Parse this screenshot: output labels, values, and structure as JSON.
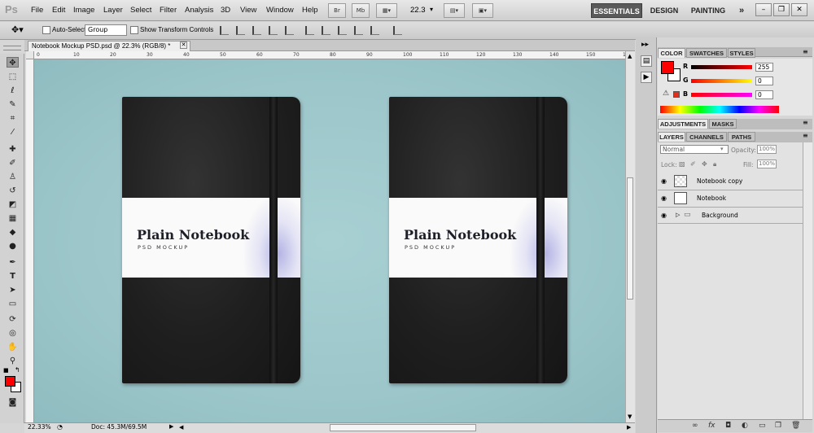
{
  "app": {
    "logo": "Ps"
  },
  "menu": [
    "File",
    "Edit",
    "Image",
    "Layer",
    "Select",
    "Filter",
    "Analysis",
    "3D",
    "View",
    "Window",
    "Help"
  ],
  "appbar": {
    "bridge_label": "Br",
    "minibridge_label": "Mb",
    "zoom": "22.3"
  },
  "workspaces": {
    "essentials": "ESSENTIALS",
    "design": "DESIGN",
    "painting": "PAINTING",
    "more": "»"
  },
  "options": {
    "auto_select_label": "Auto-Select:",
    "auto_select_value": "Group",
    "transform_label": "Show Transform Controls"
  },
  "document": {
    "tab_title": "Notebook Mockup PSD.psd @ 22.3% (RGB/8) *",
    "ruler_ticks": [
      "0",
      "10",
      "20",
      "30",
      "40",
      "50",
      "60",
      "70",
      "80",
      "90",
      "100",
      "110",
      "120",
      "130",
      "140",
      "150",
      "160"
    ],
    "zoom_status": "22.33%",
    "doc_status": "Doc: 45.3M/69.5M"
  },
  "notebooks": [
    {
      "title": "Plain Notebook",
      "subtitle": "PSD MOCKUP"
    },
    {
      "title": "Plain Notebook",
      "subtitle": "PSD MOCKUP"
    }
  ],
  "color_panel": {
    "tabs": [
      "COLOR",
      "SWATCHES",
      "STYLES"
    ],
    "r_label": "R",
    "g_label": "G",
    "b_label": "B",
    "r": "255",
    "g": "0",
    "b": "0",
    "fg_color": "#ff0000",
    "bg_color": "#ffffff"
  },
  "adjust_panel": {
    "tabs": [
      "ADJUSTMENTS",
      "MASKS"
    ]
  },
  "layers_panel": {
    "tabs": [
      "LAYERS",
      "CHANNELS",
      "PATHS"
    ],
    "blend_mode": "Normal",
    "opacity_label": "Opacity:",
    "opacity": "100%",
    "lock_label": "Lock:",
    "fill_label": "Fill:",
    "fill": "100%",
    "layers": [
      {
        "name": "Notebook copy"
      },
      {
        "name": "Notebook"
      },
      {
        "name": "Background"
      }
    ]
  }
}
